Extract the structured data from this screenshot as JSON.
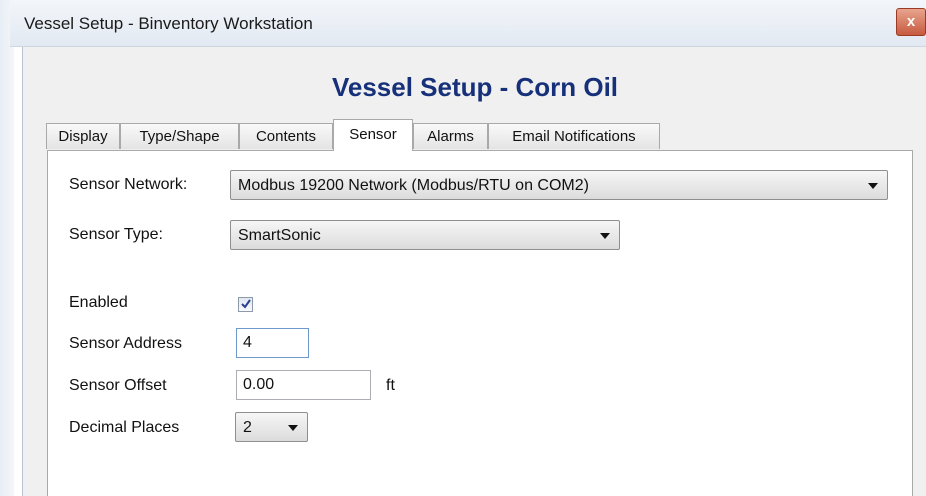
{
  "window": {
    "title": "Vessel Setup - Binventory Workstation",
    "close_glyph": "x"
  },
  "dialog": {
    "heading": "Vessel Setup - Corn Oil"
  },
  "tabs": [
    {
      "label": "Display",
      "active": false
    },
    {
      "label": "Type/Shape",
      "active": false
    },
    {
      "label": "Contents",
      "active": false
    },
    {
      "label": "Sensor",
      "active": true
    },
    {
      "label": "Alarms",
      "active": false
    },
    {
      "label": "Email Notifications",
      "active": false
    }
  ],
  "sensor": {
    "network": {
      "label": "Sensor Network:",
      "value": "Modbus 19200 Network (Modbus/RTU on COM2)"
    },
    "type": {
      "label": "Sensor Type:",
      "value": "SmartSonic"
    },
    "enabled": {
      "label": "Enabled",
      "checked": true
    },
    "address": {
      "label": "Sensor Address",
      "value": "4"
    },
    "offset": {
      "label": "Sensor Offset",
      "value": "0.00",
      "unit": "ft"
    },
    "decimal_places": {
      "label": "Decimal Places",
      "value": "2"
    }
  },
  "colors": {
    "heading": "#17307a",
    "close_button": "#c75a3f"
  }
}
